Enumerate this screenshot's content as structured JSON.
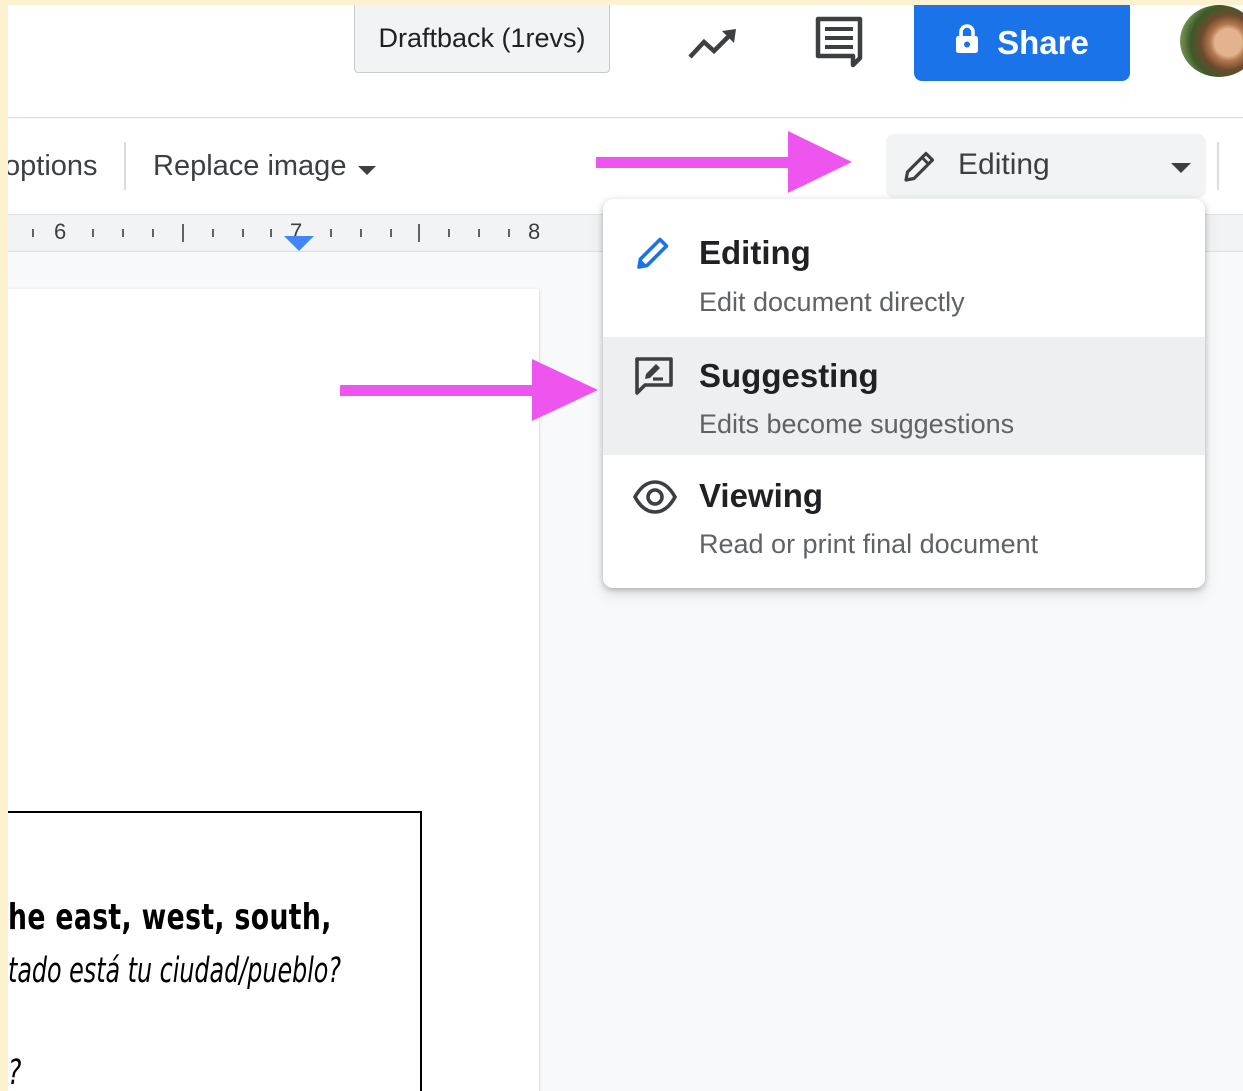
{
  "header": {
    "draftback_label": "Draftback (1revs)",
    "activity_icon": "trending-up-icon",
    "comments_icon": "comment-history-icon",
    "share_label": "Share",
    "share_icon": "lock-icon",
    "share_color": "#1a73e8"
  },
  "toolbar": {
    "image_options_label": "options",
    "replace_image_label": "Replace image",
    "mode_button_label": "Editing"
  },
  "ruler": {
    "numbers": [
      "6",
      "7",
      "8"
    ]
  },
  "mode_menu": {
    "items": [
      {
        "label": "Editing",
        "description": "Edit document directly",
        "icon": "pencil-icon",
        "highlighted": false
      },
      {
        "label": "Suggesting",
        "description": "Edits become suggestions",
        "icon": "suggest-edit-icon",
        "highlighted": true
      },
      {
        "label": "Viewing",
        "description": "Read or print final document",
        "icon": "eye-icon",
        "highlighted": false
      }
    ]
  },
  "document": {
    "lines": [
      "he east, west, south,",
      "tado está tu ciudad/pueblo?",
      "?"
    ]
  },
  "annotation": {
    "arrow_color": "#ee55ee"
  }
}
